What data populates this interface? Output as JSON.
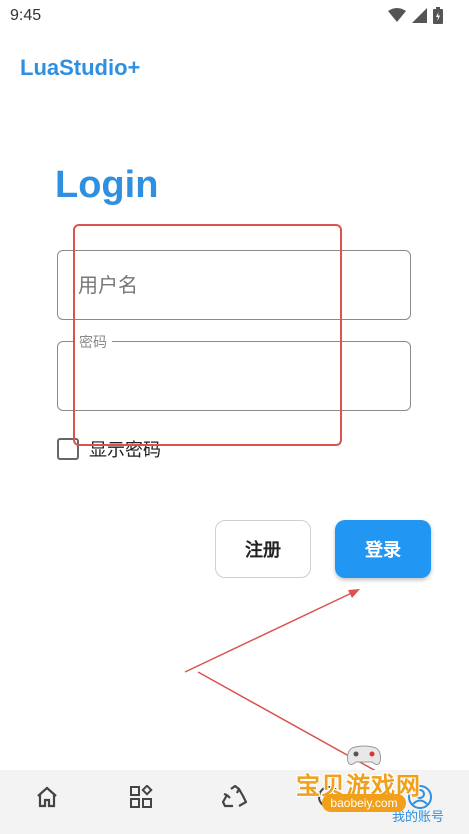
{
  "status_bar": {
    "time": "9:45"
  },
  "app": {
    "title": "LuaStudio+"
  },
  "login": {
    "heading": "Login",
    "username_placeholder": "用户名",
    "password_label": "密码",
    "show_password_label": "显示密码",
    "register_label": "注册",
    "login_label": "登录"
  },
  "bottom_nav": {
    "items": [
      {
        "icon": "home-icon"
      },
      {
        "icon": "apps-icon"
      },
      {
        "icon": "recycle-icon"
      },
      {
        "icon": "explore-icon"
      },
      {
        "icon": "account-icon",
        "label": "我的账号"
      }
    ]
  },
  "watermark": {
    "title": "宝贝游戏网",
    "url": "baobeiy.com"
  },
  "colors": {
    "accent": "#2f8fe0",
    "login_button": "#2196f3",
    "annotation": "#d9534f",
    "watermark": "#f0a01a"
  }
}
